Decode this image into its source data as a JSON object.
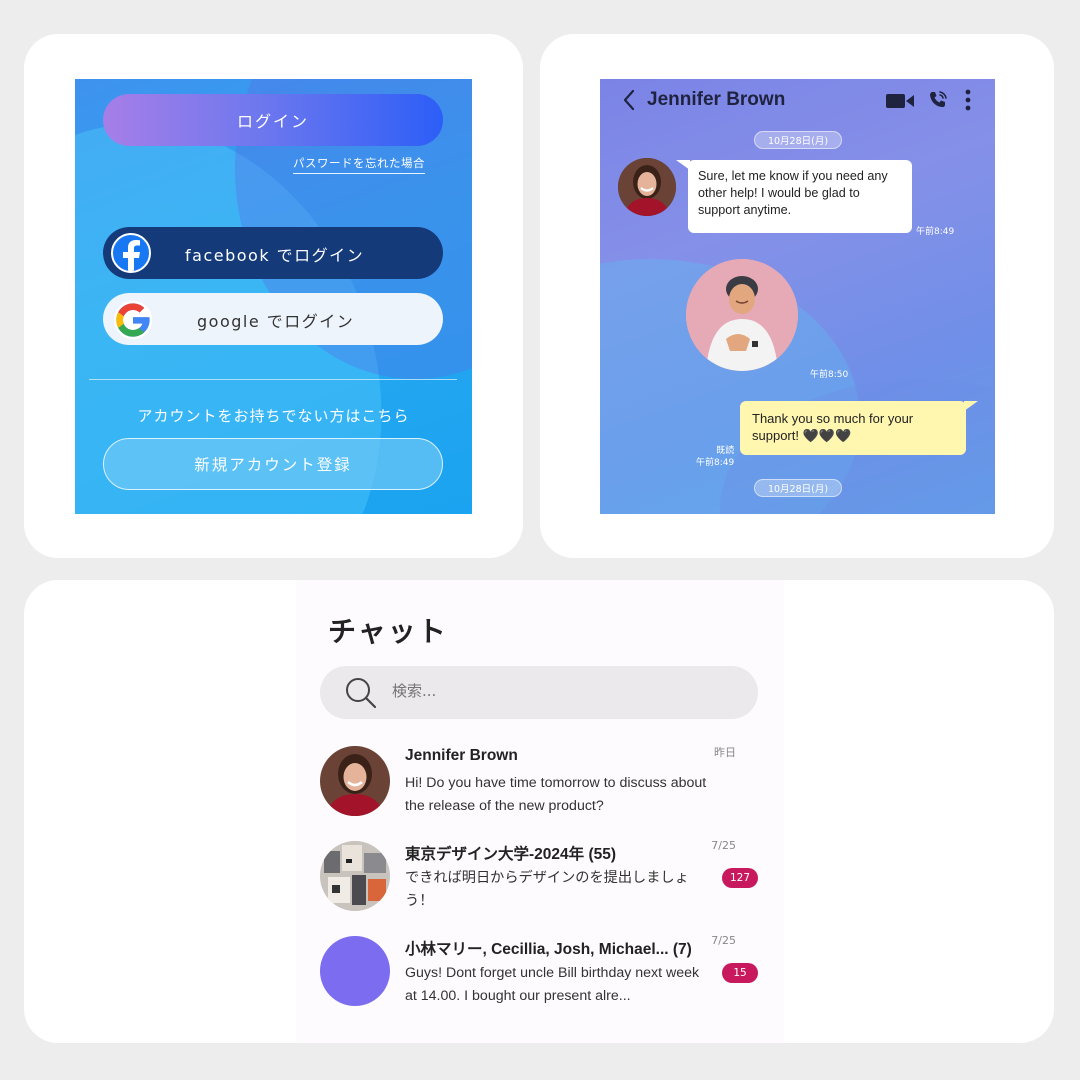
{
  "login": {
    "login_label": "ログイン",
    "forgot_password": "パスワードを忘れた場合",
    "facebook_label": "facebook でログイン",
    "google_label": "google でログイン",
    "no_account_text": "アカウントをお持ちでない方はこちら",
    "register_label": "新規アカウント登録",
    "colors": {
      "login_gradient_end": "#2c5ef7",
      "facebook_bg": "#143a7a"
    }
  },
  "chat": {
    "contact_name": "Jennifer Brown",
    "date_top": "10月28日(月)",
    "date_bottom": "10月28日(月)",
    "messages": [
      {
        "direction": "in",
        "text": "Sure, let me know if you need any other help! I would be glad to support anytime.",
        "time": "午前8:49"
      },
      {
        "direction": "in",
        "type": "sticker",
        "time": "午前8:50"
      },
      {
        "direction": "out",
        "text": "Thank you so much for your support! 🖤🖤🖤",
        "read": "既読",
        "time": "午前8:49"
      }
    ],
    "icons": [
      "back-icon",
      "video-call-icon",
      "phone-call-icon",
      "more-vertical-icon"
    ]
  },
  "chat_list": {
    "title": "チャット",
    "search_placeholder": "検索...",
    "conversations": [
      {
        "name": "Jennifer Brown",
        "preview": "Hi! Do you have time tomorrow to discuss about the release of the new product?",
        "time": "昨日",
        "badge": null
      },
      {
        "name": "東京デザイン大学-2024年 (55)",
        "preview": "できれば明日からデザインのを提出しましょう！",
        "time": "7/25",
        "badge": "127"
      },
      {
        "name": "小林マリー, Cecillia, Josh, Michael...  (7)",
        "preview": "Guys! Dont forget uncle Bill birthday next week at 14.00. I bought our present alre...",
        "time": "7/25",
        "badge": "15"
      }
    ],
    "colors": {
      "badge": "#c8195e",
      "group_avatar": "#7b6cf0"
    }
  }
}
